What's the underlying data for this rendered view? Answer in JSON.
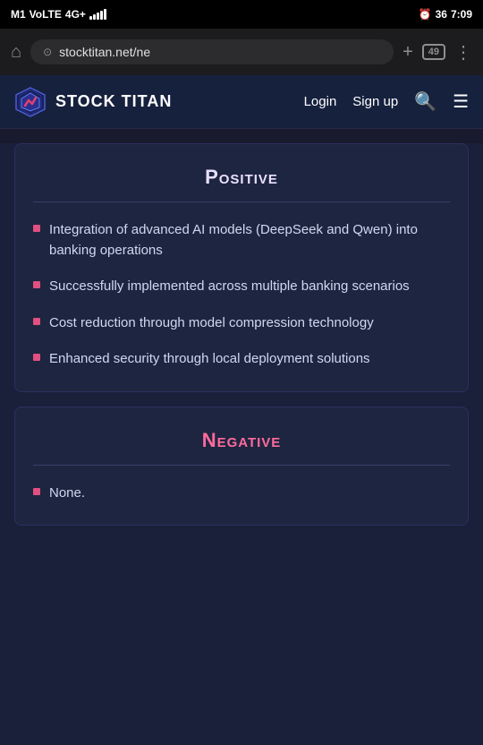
{
  "statusBar": {
    "carrier": "M1",
    "network": "VoLTE",
    "signal": "4G+",
    "alarmIcon": "⏰",
    "batteryLevel": "36",
    "time": "7:09"
  },
  "browserBar": {
    "url": "stocktitan.net/ne",
    "tabCount": "49",
    "homeIcon": "⌂",
    "addIcon": "+",
    "moreIcon": "⋮"
  },
  "nav": {
    "brand": "STOCK TITAN",
    "loginLabel": "Login",
    "signupLabel": "Sign up",
    "searchIcon": "🔍",
    "menuIcon": "☰"
  },
  "positiveSection": {
    "title": "Positive",
    "items": [
      "Integration of advanced AI models (DeepSeek and Qwen) into banking operations",
      "Successfully implemented across multiple banking scenarios",
      "Cost reduction through model compression technology",
      "Enhanced security through local deployment solutions"
    ]
  },
  "negativeSection": {
    "title": "Negative",
    "items": [
      "None."
    ]
  }
}
